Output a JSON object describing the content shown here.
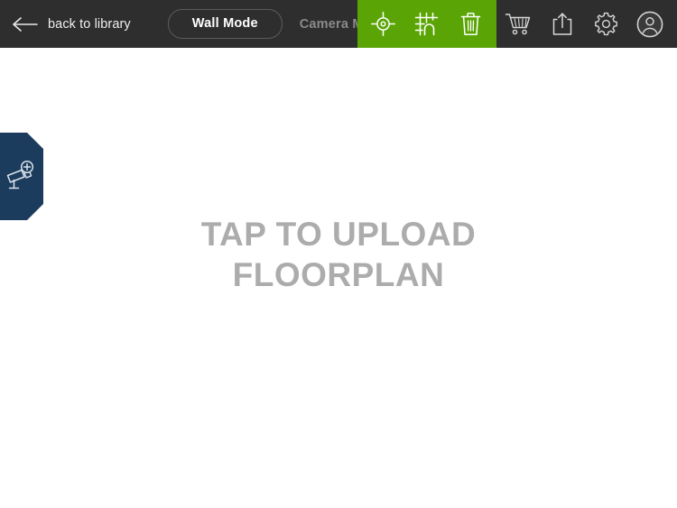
{
  "header": {
    "back_label": "back to library",
    "back_icon": "arrow-left-icon",
    "modes": [
      {
        "label": "Wall Mode",
        "active": true
      },
      {
        "label": "Camera Mode",
        "active": false
      }
    ],
    "green_tools": [
      {
        "name": "target-crosshair-icon",
        "label": "Center / Target"
      },
      {
        "name": "floorplan-wall-icon",
        "label": "Wall Tool"
      },
      {
        "name": "trash-icon",
        "label": "Delete"
      }
    ],
    "dark_tools": [
      {
        "name": "shopping-cart-icon",
        "label": "Cart"
      },
      {
        "name": "share-upload-icon",
        "label": "Share"
      },
      {
        "name": "gear-icon",
        "label": "Settings"
      },
      {
        "name": "user-avatar-icon",
        "label": "Account"
      }
    ]
  },
  "canvas": {
    "upload_line1": "TAP TO UPLOAD",
    "upload_line2": "FLOORPLAN"
  },
  "side_tab": {
    "icon": "add-camera-icon",
    "label": "Add Camera"
  },
  "colors": {
    "header_bg": "#2e2e2e",
    "accent_green": "#5aa505",
    "tab_blue": "#1c3c5e",
    "upload_text": "#acacac",
    "inactive_text": "#8a8a8a"
  }
}
